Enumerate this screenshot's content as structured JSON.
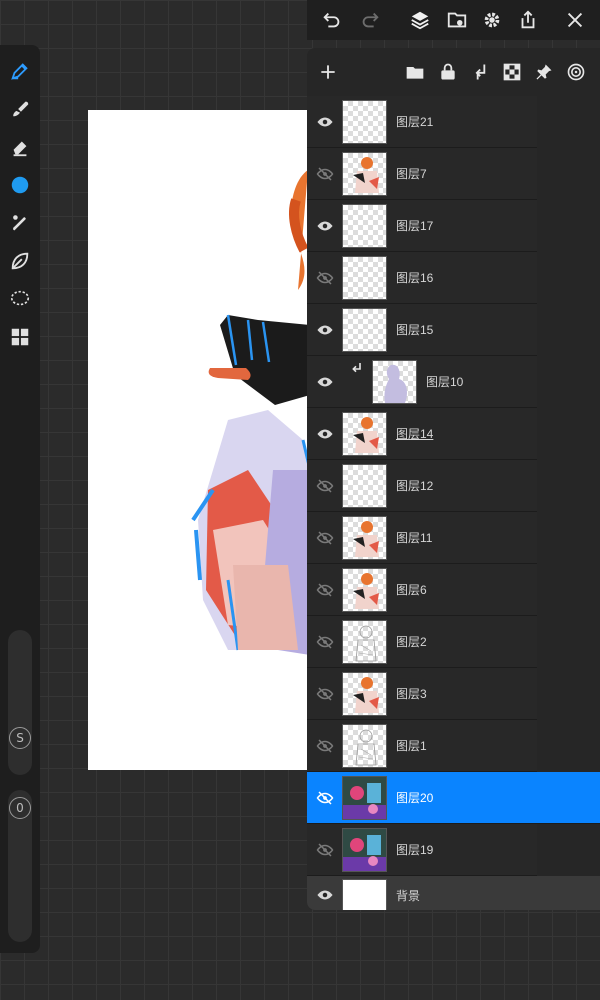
{
  "top_toolbar": {
    "buttons": [
      {
        "icon": "undo-icon"
      },
      {
        "icon": "redo-icon"
      },
      {
        "icon": "layers-icon"
      },
      {
        "icon": "import-icon"
      },
      {
        "icon": "gear-icon"
      },
      {
        "icon": "export-icon"
      },
      {
        "icon": "close-icon"
      }
    ]
  },
  "left_toolbar": {
    "tools": [
      {
        "icon": "pen-icon",
        "active": true
      },
      {
        "icon": "smudge-icon"
      },
      {
        "icon": "eraser-icon"
      },
      {
        "icon": "color-dot-icon",
        "color": "#1f9bf0"
      },
      {
        "icon": "brush-palette-icon"
      },
      {
        "icon": "leaf-icon"
      },
      {
        "icon": "lasso-icon"
      },
      {
        "icon": "grid-icon"
      }
    ],
    "size_slider_label": "S",
    "opacity_slider_label": "0"
  },
  "layer_panel": {
    "toolbar": [
      {
        "icon": "add-icon"
      },
      {
        "icon": "folder-icon"
      },
      {
        "icon": "lock-icon"
      },
      {
        "icon": "merge-down-icon"
      },
      {
        "icon": "checker-icon"
      },
      {
        "icon": "pin-icon"
      },
      {
        "icon": "spiral-icon"
      }
    ],
    "layers": [
      {
        "name": "图层21",
        "visible": true,
        "thumb": "transparent"
      },
      {
        "name": "图层7",
        "visible": false,
        "thumb": "figure"
      },
      {
        "name": "图层17",
        "visible": true,
        "thumb": "transparent"
      },
      {
        "name": "图层16",
        "visible": false,
        "thumb": "transparent"
      },
      {
        "name": "图层15",
        "visible": true,
        "thumb": "transparent"
      },
      {
        "name": "图层10",
        "visible": true,
        "thumb": "shape",
        "clipped": true
      },
      {
        "name": "图层14",
        "visible": true,
        "thumb": "figure",
        "underlined": true
      },
      {
        "name": "图层12",
        "visible": false,
        "thumb": "transparent"
      },
      {
        "name": "图层11",
        "visible": false,
        "thumb": "figure"
      },
      {
        "name": "图层6",
        "visible": false,
        "thumb": "figure"
      },
      {
        "name": "图层2",
        "visible": false,
        "thumb": "sketch"
      },
      {
        "name": "图层3",
        "visible": false,
        "thumb": "figure"
      },
      {
        "name": "图层1",
        "visible": false,
        "thumb": "sketch"
      },
      {
        "name": "图层20",
        "visible": false,
        "thumb": "photo",
        "selected": true
      },
      {
        "name": "图层19",
        "visible": false,
        "thumb": "photo"
      },
      {
        "name": "背景",
        "visible": true,
        "thumb": "white",
        "background": true
      }
    ]
  },
  "colors": {
    "accent": "#0a84ff",
    "panel": "#262626",
    "canvas": "#ffffff",
    "brush_color": "#1f9bf0"
  }
}
